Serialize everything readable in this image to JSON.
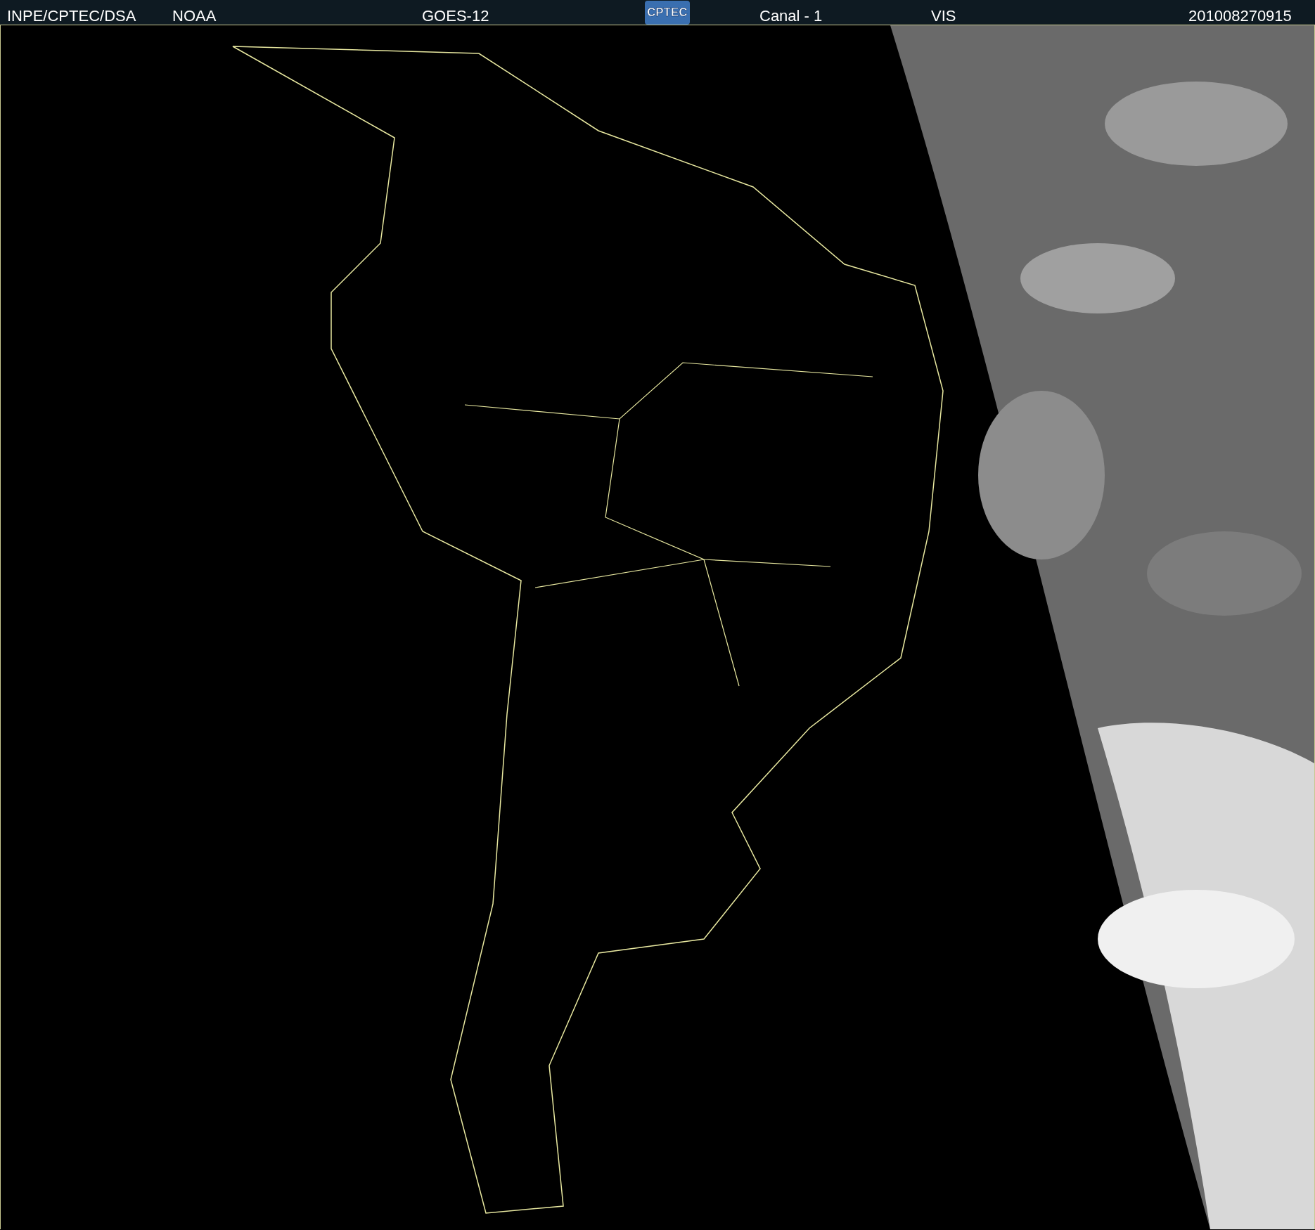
{
  "header": {
    "labels": [
      {
        "text": "INPE/CPTEC/DSA",
        "kind": "source"
      },
      {
        "text": "NOAA",
        "kind": "source"
      },
      {
        "text": "GOES-12",
        "kind": "satellite"
      },
      {
        "text": "CPTEC",
        "kind": "logo"
      },
      {
        "text": "Canal - 1",
        "kind": "channel"
      },
      {
        "text": "VIS",
        "kind": "band"
      },
      {
        "text": "201008270915",
        "kind": "timestamp"
      }
    ]
  }
}
